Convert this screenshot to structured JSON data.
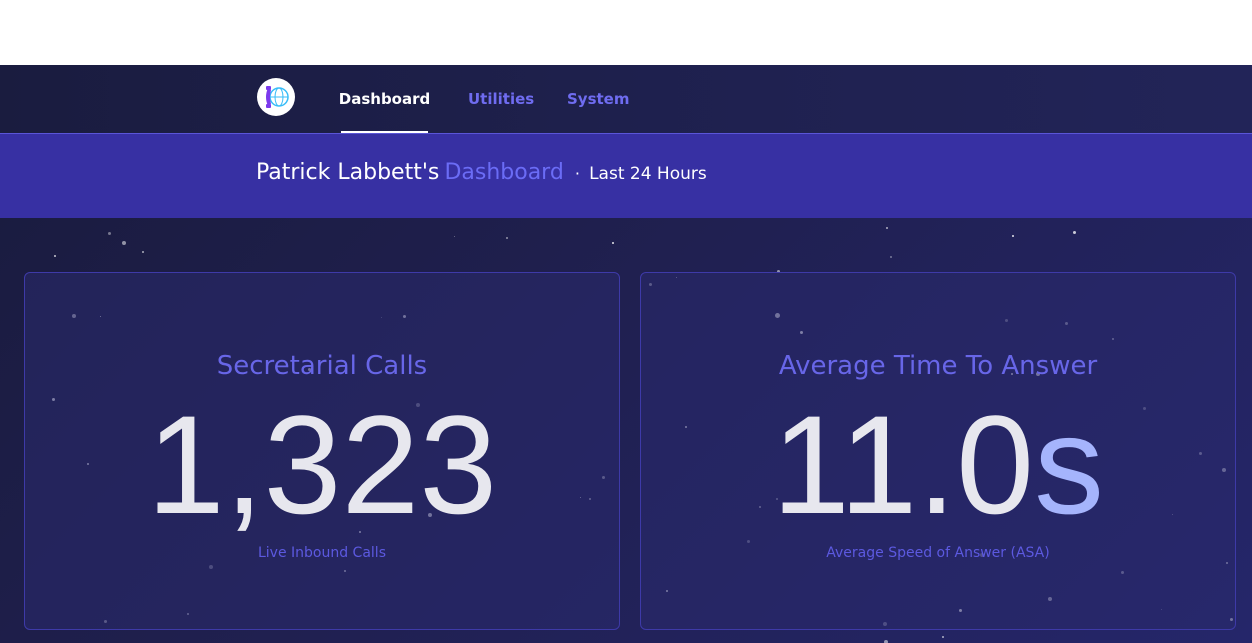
{
  "nav": {
    "tabs": [
      {
        "label": "Dashboard",
        "active": true
      },
      {
        "label": "Utilities",
        "active": false
      },
      {
        "label": "System",
        "active": false
      }
    ],
    "logo_icon": "phone-globe-logo"
  },
  "banner": {
    "name": "Patrick Labbett's",
    "dashboard": "Dashboard",
    "separator": "·",
    "period": "Last 24 Hours"
  },
  "cards": [
    {
      "title": "Secretarial Calls",
      "value": "1,323",
      "unit": "",
      "subtitle": "Live Inbound Calls"
    },
    {
      "title": "Average Time To Answer",
      "value": "11.0",
      "unit": "s",
      "subtitle": "Average Speed of Answer (ASA)"
    }
  ],
  "colors": {
    "accent": "#6b6cf6",
    "banner": "#3730a3",
    "background": "#1f1f4d",
    "value_text": "#e7e7ee",
    "unit_text": "#a5b4fc"
  }
}
